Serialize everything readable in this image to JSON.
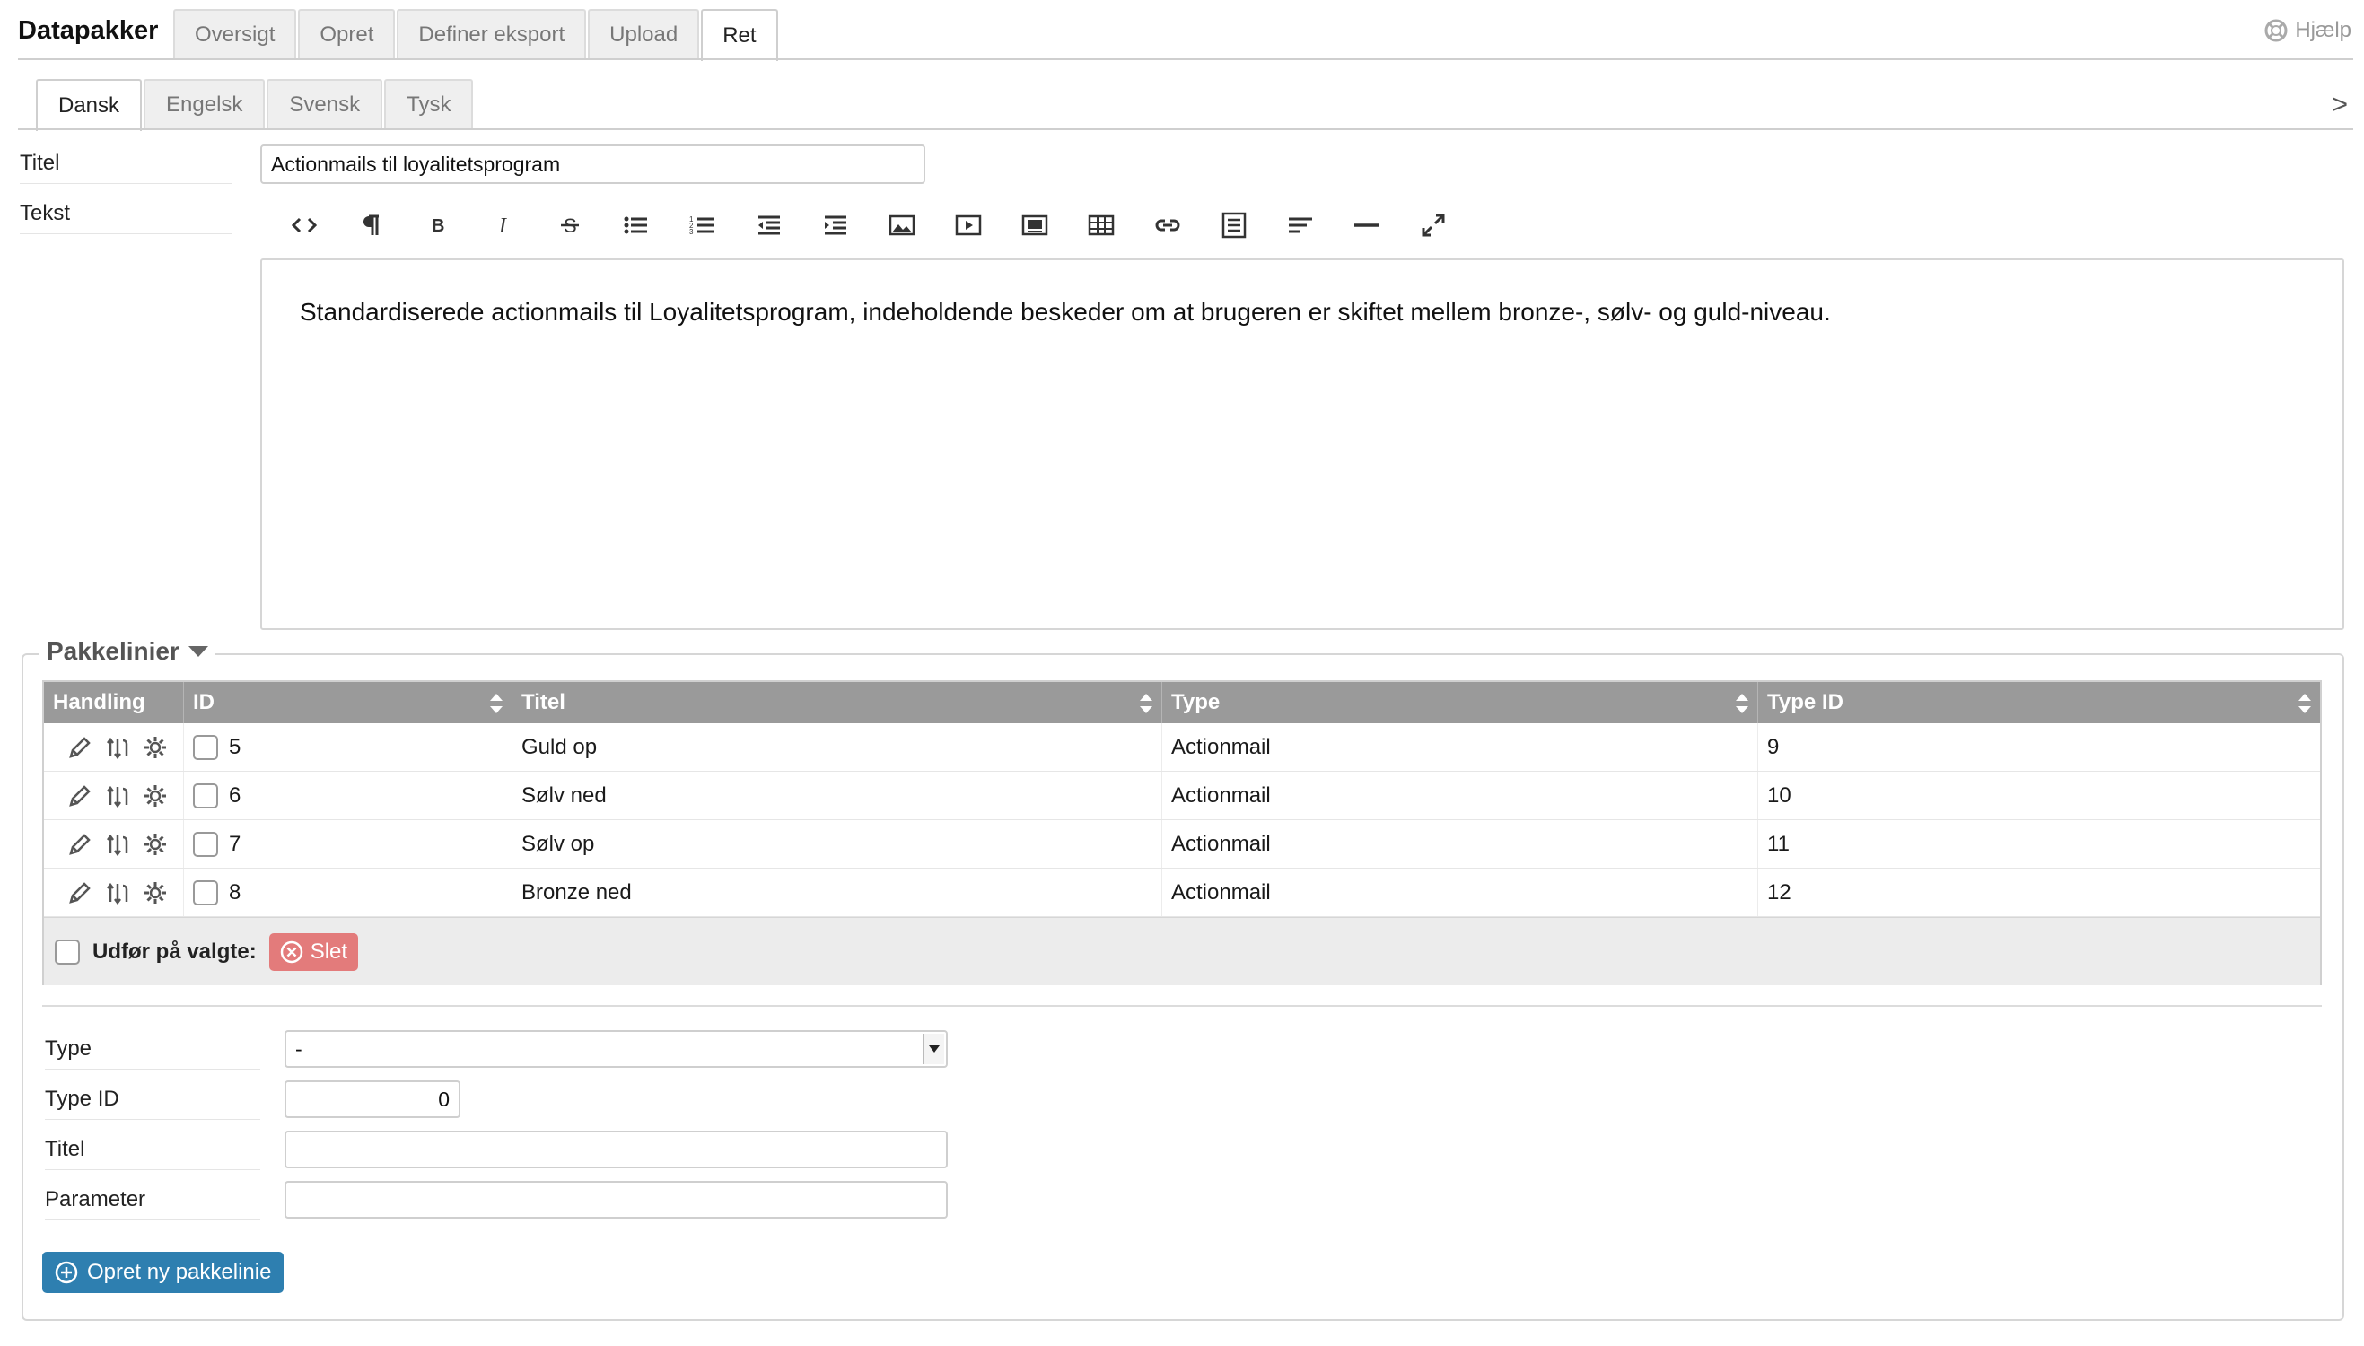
{
  "app": {
    "title": "Datapakker",
    "help_label": "Hjælp"
  },
  "top_tabs": [
    {
      "label": "Oversigt"
    },
    {
      "label": "Opret"
    },
    {
      "label": "Definer eksport"
    },
    {
      "label": "Upload"
    },
    {
      "label": "Ret",
      "active": true
    }
  ],
  "lang_tabs": [
    {
      "label": "Dansk",
      "active": true
    },
    {
      "label": "Engelsk"
    },
    {
      "label": "Svensk"
    },
    {
      "label": "Tysk"
    }
  ],
  "next_arrow": ">",
  "form": {
    "title_label": "Titel",
    "title_value": "Actionmails til loyalitetsprogram",
    "text_label": "Tekst",
    "editor_text": "Standardiserede actionmails til Loyalitetsprogram, indeholdende beskeder om at brugeren er skiftet mellem bronze-, sølv- og guld-niveau."
  },
  "toolbar_icons": [
    "code-icon",
    "paragraph-icon",
    "bold-icon",
    "italic-icon",
    "strikethrough-icon",
    "unordered-list-icon",
    "ordered-list-icon",
    "outdent-icon",
    "indent-icon",
    "image-icon",
    "video-icon",
    "file-icon",
    "table-icon",
    "link-icon",
    "align-icon",
    "align-left-icon",
    "horizontal-rule-icon",
    "fullscreen-icon"
  ],
  "packagelines": {
    "legend": "Pakkelinier",
    "columns": [
      "Handling",
      "ID",
      "Titel",
      "Type",
      "Type ID"
    ],
    "rows": [
      {
        "id": "5",
        "title": "Guld op",
        "type": "Actionmail",
        "type_id": "9"
      },
      {
        "id": "6",
        "title": "Sølv ned",
        "type": "Actionmail",
        "type_id": "10"
      },
      {
        "id": "7",
        "title": "Sølv op",
        "type": "Actionmail",
        "type_id": "11"
      },
      {
        "id": "8",
        "title": "Bronze ned",
        "type": "Actionmail",
        "type_id": "12"
      }
    ],
    "bulk_label": "Udfør på valgte:",
    "delete_label": "Slet"
  },
  "new_line": {
    "type_label": "Type",
    "type_value": "-",
    "type_id_label": "Type ID",
    "type_id_value": "0",
    "title_label": "Titel",
    "title_value": "",
    "parameter_label": "Parameter",
    "parameter_value": "",
    "create_label": "Opret ny pakkelinie"
  },
  "colors": {
    "header_gray": "#9a9a9a",
    "delete_red": "#e37b7b",
    "create_blue": "#2e7fb0"
  }
}
